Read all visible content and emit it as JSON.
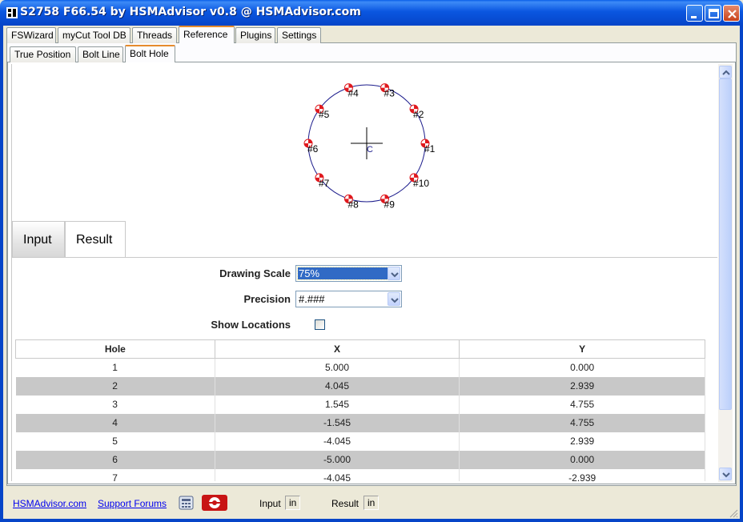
{
  "window": {
    "title": "S2758 F66.54 by HSMAdvisor v0.8 @ HSMAdvisor.com"
  },
  "main_tabs": [
    "FSWizard",
    "myCut Tool DB",
    "Threads",
    "Reference",
    "Plugins",
    "Settings"
  ],
  "main_active": "Reference",
  "sub_tabs": [
    "True Position",
    "Bolt Line",
    "Bolt Hole"
  ],
  "sub_active": "Bolt Hole",
  "drawing": {
    "center_label": "C",
    "holes": [
      "#1",
      "#2",
      "#3",
      "#4",
      "#5",
      "#6",
      "#7",
      "#8",
      "#9",
      "#10"
    ]
  },
  "view_tabs": {
    "input": "Input",
    "result": "Result"
  },
  "form": {
    "drawing_scale_label": "Drawing Scale",
    "drawing_scale_value": "75%",
    "precision_label": "Precision",
    "precision_value": "#.###",
    "show_locations_label": "Show Locations",
    "show_locations_checked": false
  },
  "table": {
    "columns": [
      "Hole",
      "X",
      "Y"
    ],
    "rows": [
      [
        "1",
        "5.000",
        "0.000"
      ],
      [
        "2",
        "4.045",
        "2.939"
      ],
      [
        "3",
        "1.545",
        "4.755"
      ],
      [
        "4",
        "-1.545",
        "4.755"
      ],
      [
        "5",
        "-4.045",
        "2.939"
      ],
      [
        "6",
        "-5.000",
        "0.000"
      ],
      [
        "7",
        "-4.045",
        "-2.939"
      ]
    ]
  },
  "status": {
    "link1": "HSMAdvisor.com",
    "link2": "Support Forums",
    "input_label": "Input",
    "input_unit": "in",
    "result_label": "Result",
    "result_unit": "in"
  },
  "colors": {
    "title_bar": "#0a56e0",
    "accent_tab": "#e68b2c",
    "selection": "#316ac5",
    "circle": "#1c1c8c",
    "hole_marker": "#e0191e"
  }
}
